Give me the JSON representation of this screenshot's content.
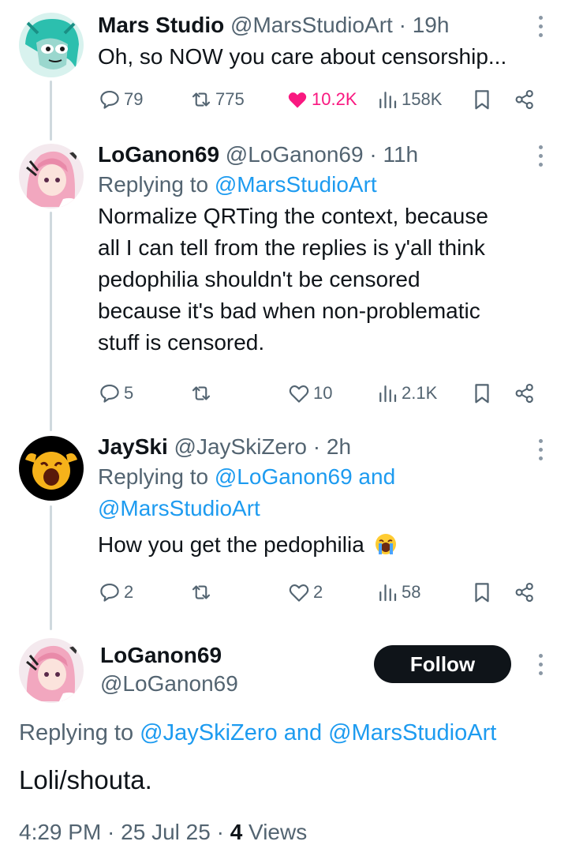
{
  "tweets": [
    {
      "name": "Mars Studio",
      "handle": "@MarsStudioArt",
      "sep": " · ",
      "time": "19h",
      "text": "Oh, so NOW you care about censorship...",
      "replies": "79",
      "retweets": "775",
      "likes": "10.2K",
      "views": "158K",
      "liked": true
    },
    {
      "name": "LoGanon69",
      "handle": "@LoGanon69",
      "sep": " · ",
      "time": "11h",
      "replying_prefix": "Replying to ",
      "replying_to": "@MarsStudioArt",
      "text_lines": [
        "Normalize QRTing the context, because",
        "all I can tell from the replies is y'all think",
        "pedophilia shouldn't be censored",
        "because it's bad when non-problematic",
        "stuff is censored."
      ],
      "replies": "5",
      "retweets": "",
      "likes": "10",
      "views": "2.1K"
    },
    {
      "name": "JaySki",
      "handle": "@JaySkiZero",
      "sep": " · ",
      "time": "2h",
      "replying_prefix": "Replying to ",
      "replying_to_1": "@LoGanon69 and",
      "replying_to_2": "@MarsStudioArt",
      "text": "How you get the pedophilia",
      "emoji": "loudly-crying-face",
      "replies": "2",
      "retweets": "",
      "likes": "2",
      "views": "58"
    }
  ],
  "main_tweet": {
    "name": "LoGanon69",
    "handle": "@LoGanon69",
    "follow_label": "Follow",
    "replying_prefix": "Replying to ",
    "replying_to": "@JaySkiZero and @MarsStudioArt",
    "text": "Loli/shouta.",
    "timestamp": "4:29 PM · 25 Jul 25 · ",
    "views_count": "4",
    "views_label": " Views"
  },
  "colors": {
    "text": "#0f1419",
    "secondary": "#536471",
    "link": "#1d9bf0",
    "like": "#f91880",
    "thread_line": "#cfd9de"
  },
  "icons": [
    "reply-icon",
    "retweet-icon",
    "like-icon",
    "views-icon",
    "bookmark-icon",
    "share-icon",
    "more-icon"
  ]
}
